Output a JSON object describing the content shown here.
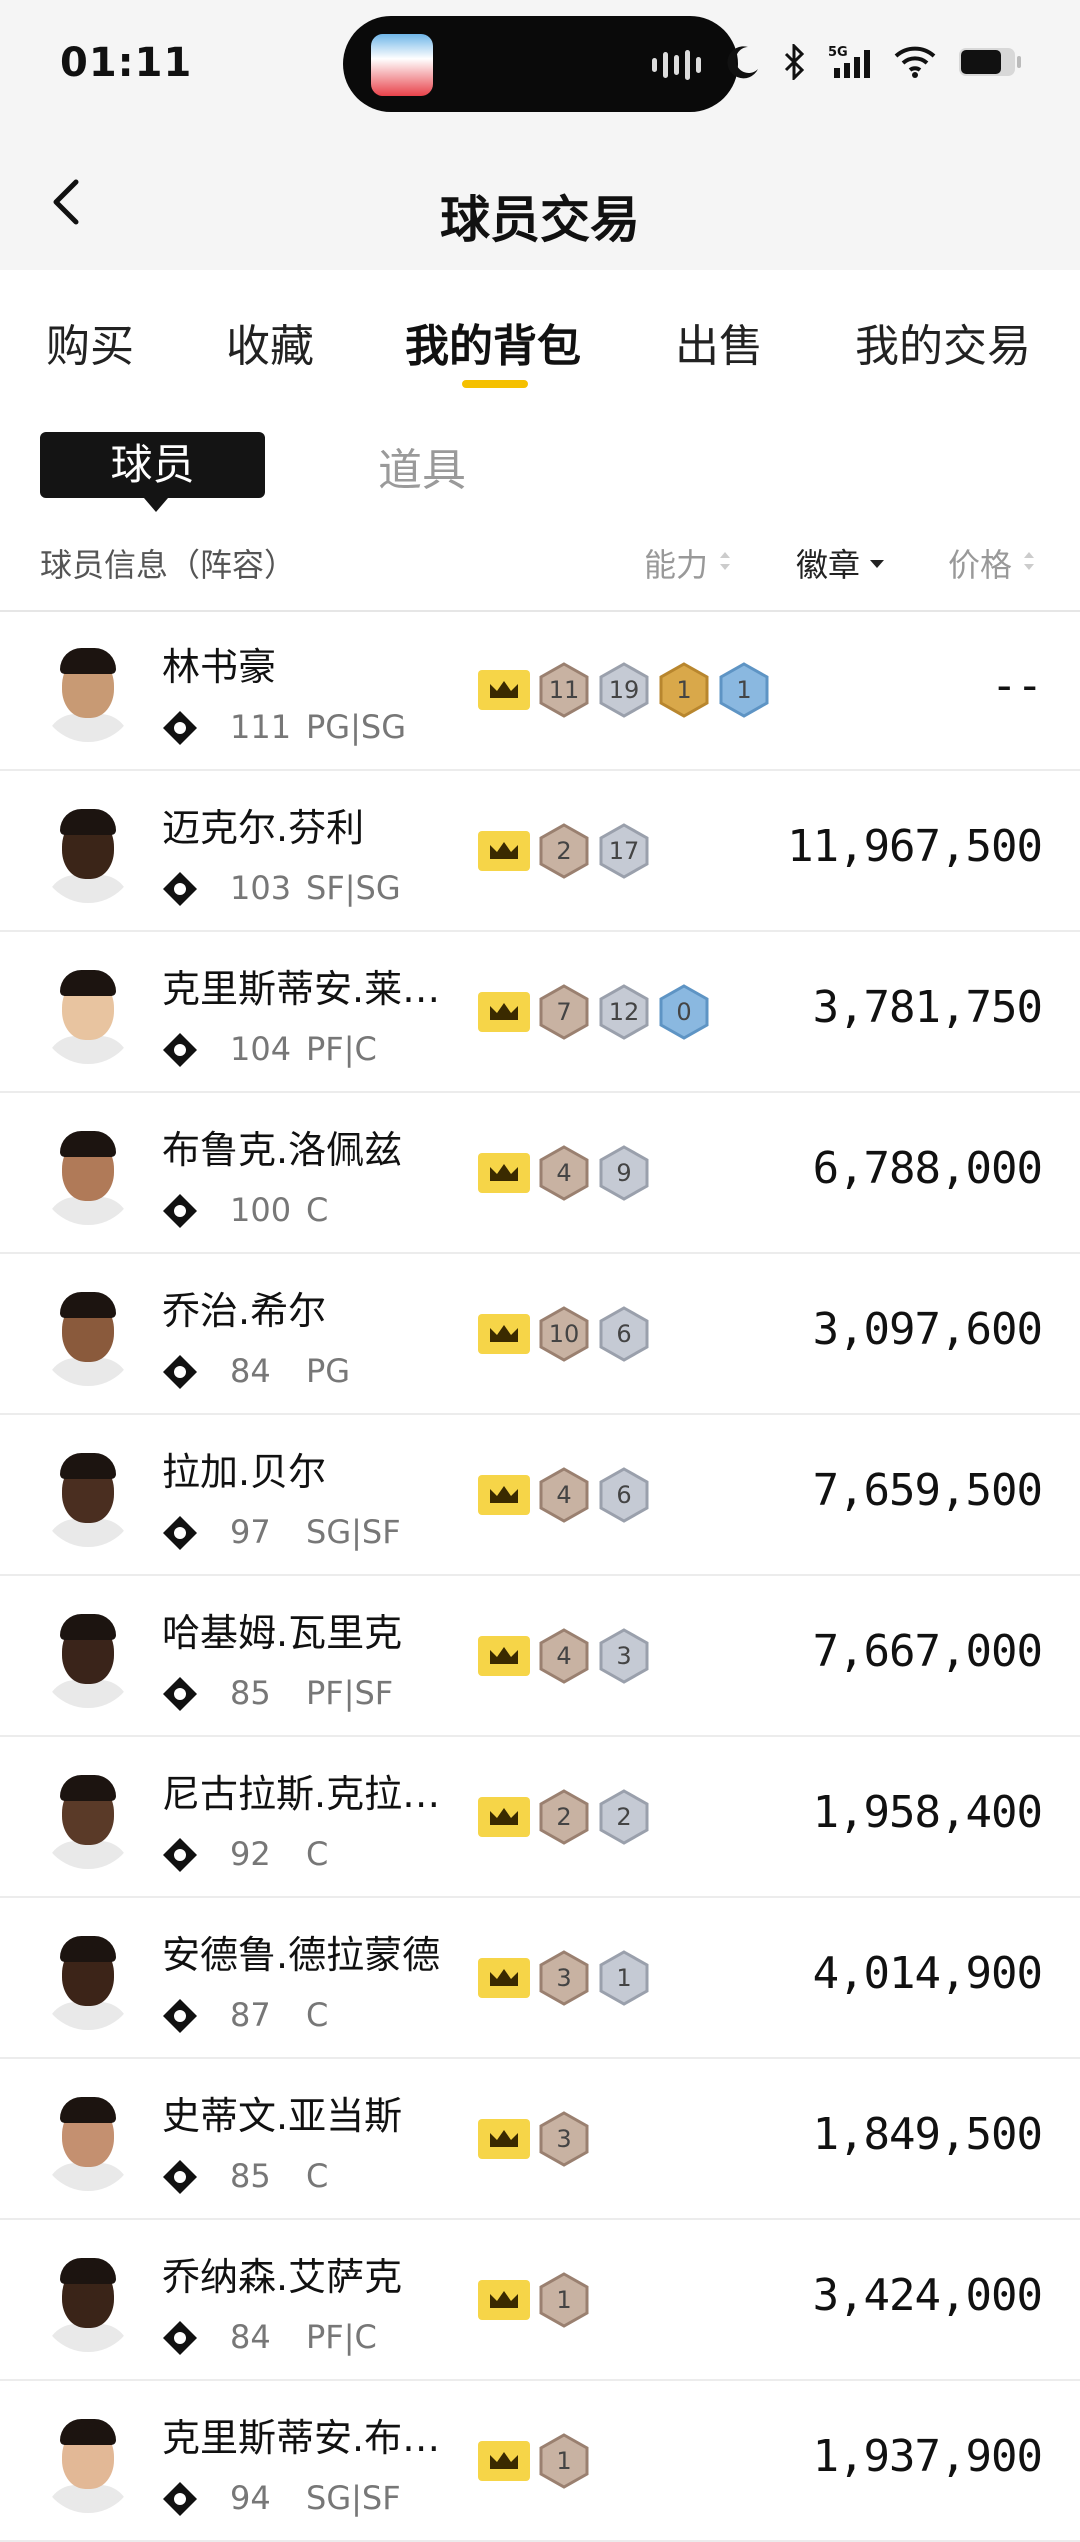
{
  "status": {
    "time": "01:11"
  },
  "header": {
    "title": "球员交易"
  },
  "tabs": [
    "购买",
    "收藏",
    "我的背包",
    "出售",
    "我的交易"
  ],
  "subtabs": [
    "球员",
    "道具"
  ],
  "columns": {
    "info": "球员信息（阵容）",
    "ability": "能力",
    "badge": "徽章",
    "price": "价格"
  },
  "colors": {
    "accent": "#f5c000",
    "crown": "#f6d548"
  },
  "players": [
    {
      "name": "林书豪",
      "rating": "111",
      "pos": "PG|SG",
      "price": "--",
      "badges": [
        [
          "11",
          "bronze"
        ],
        [
          "19",
          "silver"
        ],
        [
          "1",
          "gold"
        ],
        [
          "1",
          "blue"
        ]
      ]
    },
    {
      "name": "迈克尔.芬利",
      "rating": "103",
      "pos": "SF|SG",
      "price": "11,967,500",
      "badges": [
        [
          "2",
          "bronze"
        ],
        [
          "17",
          "silver"
        ]
      ]
    },
    {
      "name": "克里斯蒂安.莱…",
      "rating": "104",
      "pos": "PF|C",
      "price": "3,781,750",
      "badges": [
        [
          "7",
          "bronze"
        ],
        [
          "12",
          "silver"
        ],
        [
          "0",
          "blue"
        ]
      ]
    },
    {
      "name": "布鲁克.洛佩兹",
      "rating": "100",
      "pos": "C",
      "price": "6,788,000",
      "badges": [
        [
          "4",
          "bronze"
        ],
        [
          "9",
          "silver"
        ]
      ]
    },
    {
      "name": "乔治.希尔",
      "rating": "84",
      "pos": "PG",
      "price": "3,097,600",
      "badges": [
        [
          "10",
          "bronze"
        ],
        [
          "6",
          "silver"
        ]
      ]
    },
    {
      "name": "拉加.贝尔",
      "rating": "97",
      "pos": "SG|SF",
      "price": "7,659,500",
      "badges": [
        [
          "4",
          "bronze"
        ],
        [
          "6",
          "silver"
        ]
      ]
    },
    {
      "name": "哈基姆.瓦里克",
      "rating": "85",
      "pos": "PF|SF",
      "price": "7,667,000",
      "badges": [
        [
          "4",
          "bronze"
        ],
        [
          "3",
          "silver"
        ]
      ]
    },
    {
      "name": "尼古拉斯.克拉…",
      "rating": "92",
      "pos": "C",
      "price": "1,958,400",
      "badges": [
        [
          "2",
          "bronze"
        ],
        [
          "2",
          "silver"
        ]
      ]
    },
    {
      "name": "安德鲁.德拉蒙德",
      "rating": "87",
      "pos": "C",
      "price": "4,014,900",
      "badges": [
        [
          "3",
          "bronze"
        ],
        [
          "1",
          "silver"
        ]
      ]
    },
    {
      "name": "史蒂文.亚当斯",
      "rating": "85",
      "pos": "C",
      "price": "1,849,500",
      "badges": [
        [
          "3",
          "bronze"
        ]
      ]
    },
    {
      "name": "乔纳森.艾萨克",
      "rating": "84",
      "pos": "PF|C",
      "price": "3,424,000",
      "badges": [
        [
          "1",
          "bronze"
        ]
      ]
    },
    {
      "name": "克里斯蒂安.布…",
      "rating": "94",
      "pos": "SG|SF",
      "price": "1,937,900",
      "badges": [
        [
          "1",
          "bronze"
        ]
      ]
    }
  ]
}
